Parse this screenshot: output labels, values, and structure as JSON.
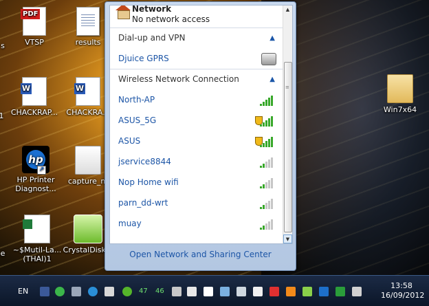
{
  "desktop": {
    "icons": [
      {
        "label": "VTSP"
      },
      {
        "label": "results"
      },
      {
        "label": "CHACKRAP...",
        "label2": "CHACKRA..."
      },
      {
        "label": "HP Printer",
        "label2": "Diagnost..."
      },
      {
        "label": "capture_m"
      },
      {
        "label": "~$Mutil-La...",
        "label2": "(THAI)1"
      },
      {
        "label": "CrystalDisk..."
      },
      {
        "label": "Win7x64"
      }
    ],
    "edge_labels": [
      "s",
      "1",
      "e"
    ]
  },
  "network": {
    "title": "Network",
    "status": "No network access",
    "sections": [
      {
        "label": "Dial-up and VPN",
        "items": [
          {
            "name": "Djuice GPRS",
            "type": "modem"
          }
        ]
      },
      {
        "label": "Wireless Network Connection",
        "items": [
          {
            "name": "North-AP",
            "signal": 5,
            "secured": false
          },
          {
            "name": "ASUS_5G",
            "signal": 5,
            "secured": true
          },
          {
            "name": "ASUS",
            "signal": 5,
            "secured": true
          },
          {
            "name": "jservice8844",
            "signal": 2,
            "secured": false
          },
          {
            "name": "Nop Home wifi",
            "signal": 2,
            "secured": false
          },
          {
            "name": "parn_dd-wrt",
            "signal": 2,
            "secured": false
          },
          {
            "name": "muay",
            "signal": 2,
            "secured": false
          }
        ]
      }
    ],
    "footer_link": "Open Network and Sharing Center"
  },
  "taskbar": {
    "language": "EN",
    "tray_numbers": [
      "47",
      "46"
    ],
    "time": "13:58",
    "date": "16/09/2012"
  }
}
